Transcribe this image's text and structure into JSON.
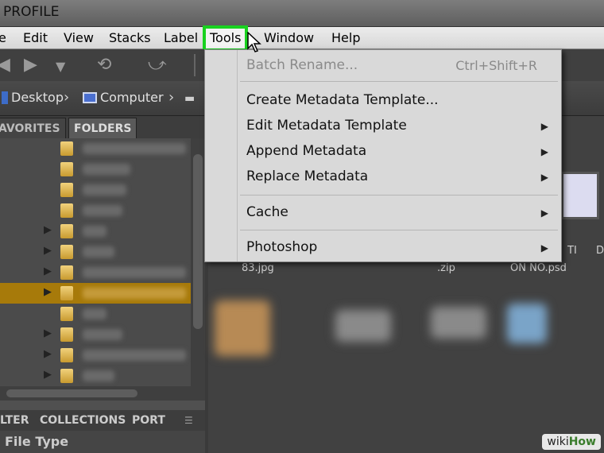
{
  "window": {
    "title": "PROFILE"
  },
  "menubar": {
    "items": [
      "e",
      "Edit",
      "View",
      "Stacks",
      "Label",
      "Tools",
      "Window",
      "Help"
    ],
    "active": "Tools"
  },
  "pathbar": {
    "items": [
      "Desktop",
      "Computer"
    ]
  },
  "panels": {
    "top_tabs": [
      "AVORITES",
      "FOLDERS"
    ],
    "bottom_tabs": [
      "LTER",
      "COLLECTIONS",
      "PORT"
    ],
    "filter_header": "File Type"
  },
  "content": {
    "labels": [
      "83.jpg",
      ".zip",
      "TI",
      "ON NO.psd",
      "D"
    ]
  },
  "tools_menu": {
    "batch_rename": {
      "label": "Batch Rename...",
      "shortcut": "Ctrl+Shift+R"
    },
    "create_template": "Create Metadata Template...",
    "edit_template": "Edit Metadata Template",
    "append": "Append Metadata",
    "replace": "Replace Metadata",
    "cache": "Cache",
    "photoshop": "Photoshop"
  },
  "watermark": {
    "prefix": "wiki",
    "suffix": "How"
  },
  "colors": {
    "highlight": "#19d21f",
    "selection": "#a77a0a"
  }
}
